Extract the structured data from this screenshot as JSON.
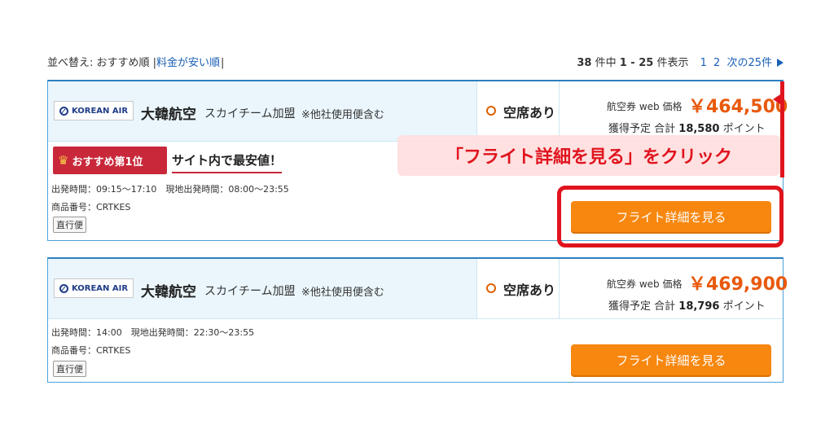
{
  "topbar": {
    "sort_label": "並べ替え: おすすめ順 |",
    "sort_link": "料金が安い順",
    "sort_tail": "|",
    "count_num": "38",
    "count_mid": " 件中 ",
    "count_range": "1 - 25",
    "count_tail": " 件表示",
    "page1": "1",
    "page2": "2",
    "next_label": "次の25件"
  },
  "flights": [
    {
      "logo_text": "KOREAN AIR",
      "airline": "大韓航空",
      "alliance": "スカイチーム加盟",
      "note": "※他社使用便含む",
      "seat": "空席あり",
      "price_label": "航空券 web 価格",
      "price": "￥464,500",
      "points_prefix": "獲得予定 合計",
      "points": "18,580",
      "points_suffix": "ポイント",
      "badge": "おすすめ第1位",
      "cheapest": "サイト内で最安値！",
      "times": "出発時間：09:15〜17:10　現地出発時間：08:00〜23:55",
      "product": "商品番号：CRTKES",
      "tag": "直行便",
      "button": "フライト詳細を見る"
    },
    {
      "logo_text": "KOREAN AIR",
      "airline": "大韓航空",
      "alliance": "スカイチーム加盟",
      "note": "※他社使用便含む",
      "seat": "空席あり",
      "price_label": "航空券 web 価格",
      "price": "￥469,900",
      "points_prefix": "獲得予定 合計",
      "points": "18,796",
      "points_suffix": "ポイント",
      "times": "出発時間：14:00　現地出発時間：22:30〜23:55",
      "product": "商品番号：CRTKES",
      "tag": "直行便",
      "button": "フライト詳細を見る"
    }
  ],
  "annotation": {
    "callout": "「フライト詳細を見る」をクリック"
  },
  "colors": {
    "accent_orange": "#f7870f",
    "price_orange": "#e8590c",
    "highlight_red": "#e0141e",
    "link_blue": "#1a5fb4"
  }
}
